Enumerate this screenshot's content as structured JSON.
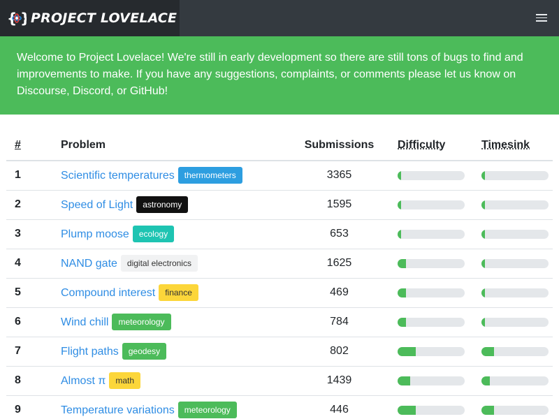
{
  "brand": {
    "name": "PROJECT LOVELACE",
    "logo_icon": "braces-atom-logo-icon"
  },
  "nav": {
    "menu_icon": "hamburger-menu-icon"
  },
  "alert": {
    "text": "Welcome to Project Lovelace! We're still in early development so there are still tons of bugs to find and improvements to make. If you have any suggestions, complaints, or comments please let us know on Discourse, Discord, or GitHub!"
  },
  "table": {
    "headers": {
      "number": "#",
      "problem": "Problem",
      "submissions": "Submissions",
      "difficulty": "Difficulty",
      "timesink": "Timesink"
    },
    "rows": [
      {
        "number": "1",
        "problem": "Scientific temperatures",
        "tag": "thermometers",
        "tag_bg": "#2d9ee0",
        "tag_fg": "#ffffff",
        "submissions": "3365",
        "difficulty": 0.05,
        "timesink": 0.05
      },
      {
        "number": "2",
        "problem": "Speed of Light",
        "tag": "astronomy",
        "tag_bg": "#111111",
        "tag_fg": "#ffffff",
        "submissions": "1595",
        "difficulty": 0.05,
        "timesink": 0.05
      },
      {
        "number": "3",
        "problem": "Plump moose",
        "tag": "ecology",
        "tag_bg": "#1ec4b2",
        "tag_fg": "#ffffff",
        "submissions": "653",
        "difficulty": 0.05,
        "timesink": 0.05
      },
      {
        "number": "4",
        "problem": "NAND gate",
        "tag": "digital electronics",
        "tag_bg": "#f1f2f3",
        "tag_fg": "#333333",
        "submissions": "1625",
        "difficulty": 0.13,
        "timesink": 0.05
      },
      {
        "number": "5",
        "problem": "Compound interest",
        "tag": "finance",
        "tag_bg": "#fcd63a",
        "tag_fg": "#333333",
        "submissions": "469",
        "difficulty": 0.13,
        "timesink": 0.05
      },
      {
        "number": "6",
        "problem": "Wind chill",
        "tag": "meteorology",
        "tag_bg": "#4cbb5a",
        "tag_fg": "#ffffff",
        "submissions": "784",
        "difficulty": 0.13,
        "timesink": 0.05
      },
      {
        "number": "7",
        "problem": "Flight paths",
        "tag": "geodesy",
        "tag_bg": "#4cbb5a",
        "tag_fg": "#ffffff",
        "submissions": "802",
        "difficulty": 0.27,
        "timesink": 0.19
      },
      {
        "number": "8",
        "problem": "Almost π",
        "tag": "math",
        "tag_bg": "#fcd63a",
        "tag_fg": "#333333",
        "submissions": "1439",
        "difficulty": 0.19,
        "timesink": 0.13
      },
      {
        "number": "9",
        "problem": "Temperature variations",
        "tag": "meteorology",
        "tag_bg": "#4cbb5a",
        "tag_fg": "#ffffff",
        "submissions": "446",
        "difficulty": 0.27,
        "timesink": 0.19
      }
    ]
  }
}
